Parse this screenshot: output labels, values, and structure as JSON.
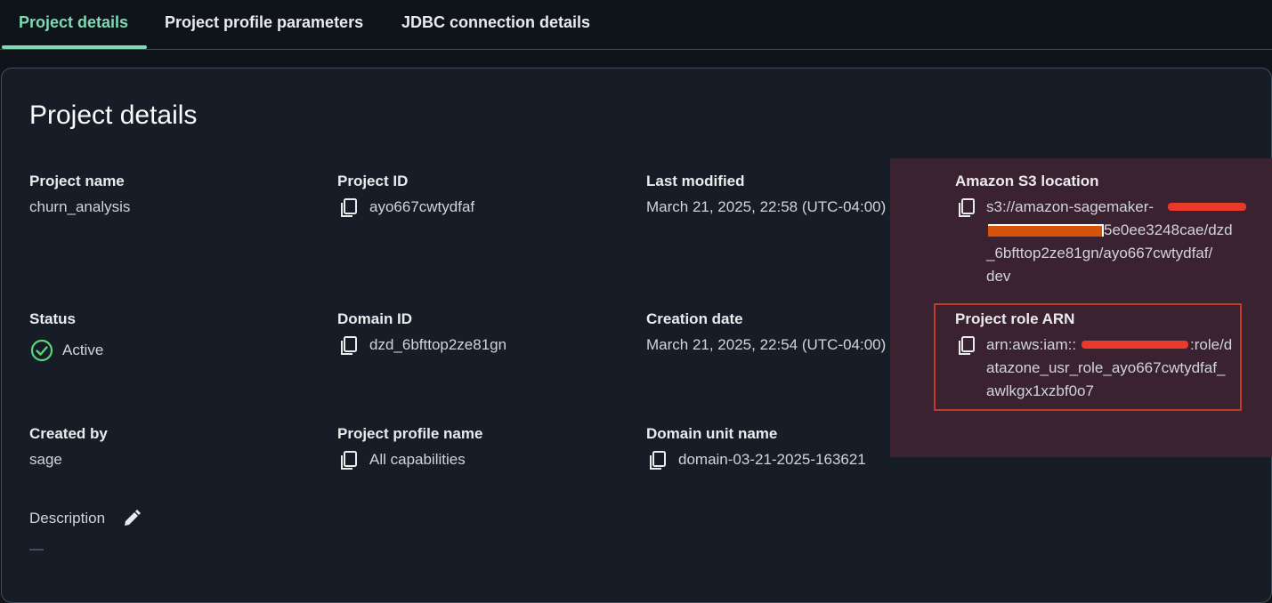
{
  "tabs": [
    {
      "label": "Project details",
      "active": true
    },
    {
      "label": "Project profile parameters",
      "active": false
    },
    {
      "label": "JDBC connection details",
      "active": false
    }
  ],
  "panel": {
    "title": "Project details"
  },
  "fields": {
    "project_name": {
      "label": "Project name",
      "value": "churn_analysis"
    },
    "project_id": {
      "label": "Project ID",
      "value": "ayo667cwtydfaf",
      "icon": "copy-icon"
    },
    "last_modified": {
      "label": "Last modified",
      "value": "March 21, 2025, 22:58 (UTC-04:00)"
    },
    "s3_location": {
      "label": "Amazon S3 location",
      "icon": "copy-icon",
      "lines": [
        "s3://amazon-sagemaker-",
        "5e0ee3248cae/dzd",
        "_6bfttop2ze81gn/ayo667cwtydfaf/",
        "dev"
      ]
    },
    "status": {
      "label": "Status",
      "value": "Active",
      "icon": "check-circle-icon",
      "color": "#5fd37a"
    },
    "domain_id": {
      "label": "Domain ID",
      "value": "dzd_6bfttop2ze81gn",
      "icon": "copy-icon"
    },
    "creation_date": {
      "label": "Creation date",
      "value": "March 21, 2025, 22:54 (UTC-04:00)"
    },
    "role_arn": {
      "label": "Project role ARN",
      "icon": "copy-icon",
      "lines": [
        "arn:aws:iam::",
        ":role/d",
        "atazone_usr_role_ayo667cwtydfaf_",
        "awlkgx1xzbf0o7"
      ]
    },
    "created_by": {
      "label": "Created by",
      "value": "sage"
    },
    "profile_name": {
      "label": "Project profile name",
      "value": "All capabilities",
      "icon": "copy-icon"
    },
    "domain_unit": {
      "label": "Domain unit name",
      "value": "domain-03-21-2025-163621",
      "icon": "copy-icon"
    },
    "description": {
      "label": "Description",
      "value": "—",
      "icon": "pencil-icon"
    }
  },
  "colors": {
    "accent": "#7fd9b5",
    "background": "#0f141a",
    "panel": "#161d26",
    "highlight": "#3b2230",
    "annotation": "#c0392b"
  }
}
